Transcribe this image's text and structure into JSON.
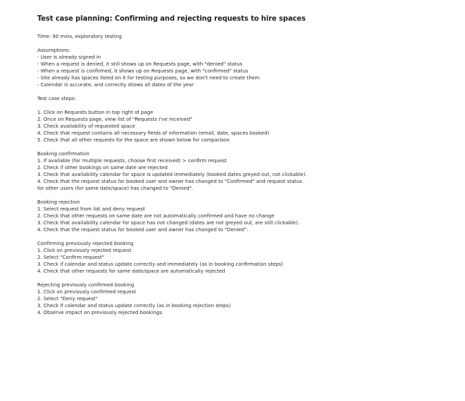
{
  "title": "Test case planning: Confirming and rejecting requests to hire spaces",
  "sections": [
    {
      "lines": [
        "Time: 90 mins, exploratory testing"
      ]
    },
    {
      "lines": [
        "Assumptions:",
        "- User is already signed in",
        "- When a request is denied, it still shows up on Requests page, with \"denied\" status",
        "- When a request is confirmed, it shows up on Requests page, with \"confirmed\" status",
        "- Site already has spaces listed on it for testing purposes, so we don't need to create them",
        "- Calendar is accurate, and correctly shows all dates of the year"
      ]
    },
    {
      "lines": [
        "Test case steps:"
      ]
    },
    {
      "lines": [
        "1. Click on Requests button in top right of page",
        "2. Once on Requests page, view list of \"Requests I've received\"",
        "3. Check availability of requested space",
        "4. Check that request contains all necessary fields of information (email, date, spaces booked)",
        "5. Check that all other requests for the space are shown below for comparison"
      ]
    },
    {
      "lines": [
        "Booking confirmation",
        "1. If available (for multiple requests, choose first received) > confirm request",
        "2. Check if other bookings on same date are rejected",
        "3. Check that availability calendar for space is updated immediately (booked dates greyed out, not clickable).",
        "4. Check that the request status for booked user and owner has changed to \"Confirmed\" and request status",
        "for other users (for same date/space) has changed to \"Denied\"."
      ]
    },
    {
      "lines": [
        "Booking rejection",
        "1. Select request from list and deny request",
        "2. Check that other requests on same date are not automatically confirmed and have no change",
        "3. Check that availability calendar for space has not changed (dates are not greyed out, are still clickable).",
        "4. Check that the request status for booked user and owner has changed to \"Denied\"."
      ]
    },
    {
      "lines": [
        "Confirming previously rejected booking",
        "1. Click on previously rejected request",
        "2. Select \"Confirm request\"",
        "3. Check if calendar and status update correctly and immediately (as in booking confirmation steps)",
        "4. Check that other requests for same date/space are automatically rejected"
      ]
    },
    {
      "lines": [
        "Rejecting previously confirmed booking",
        "1. Click on previously confirmed request",
        "2. Select \"Deny request\"",
        "3. Check if calendar and status update correctly (as in booking rejection steps)",
        "4. Observe impact on previously rejected bookings."
      ]
    }
  ]
}
